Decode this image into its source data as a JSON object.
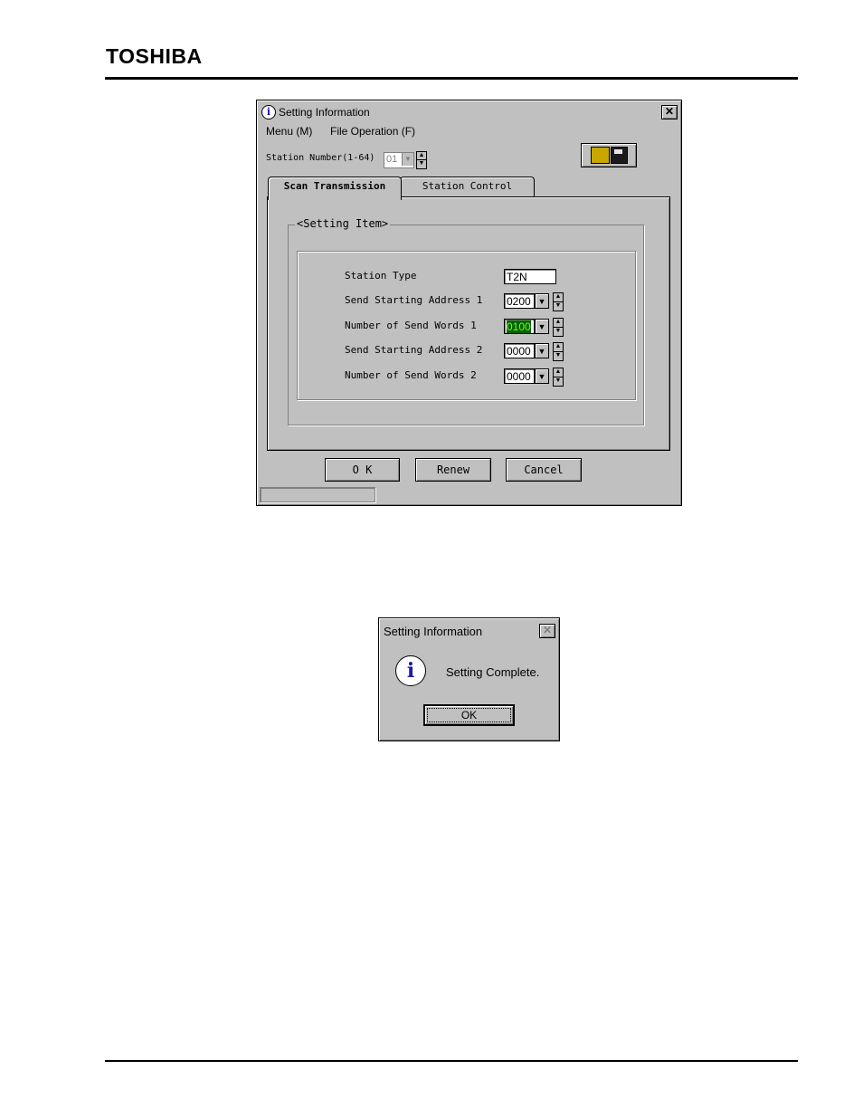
{
  "header": {
    "brand": "TOSHIBA"
  },
  "main_window": {
    "title": "Setting Information",
    "menu": [
      {
        "label": "Menu (M)"
      },
      {
        "label": "File Operation (F)"
      }
    ],
    "station_number": {
      "label": "Station Number(1-64)",
      "value": "01"
    },
    "tabs": [
      {
        "label": "Scan Transmission",
        "active": true
      },
      {
        "label": "Station Control",
        "active": false
      }
    ],
    "group_label": "<Setting Item>",
    "fields": {
      "station_type": {
        "label": "Station Type",
        "value": "T2N"
      },
      "send_start_1": {
        "label": "Send Starting Address 1",
        "value": "0200"
      },
      "send_words_1": {
        "label": "Number of Send Words 1",
        "value": "0100"
      },
      "send_start_2": {
        "label": "Send Starting Address 2",
        "value": "0000"
      },
      "send_words_2": {
        "label": "Number of Send Words 2",
        "value": "0000"
      }
    },
    "buttons": {
      "ok": "O K",
      "renew": "Renew",
      "cancel": "Cancel"
    }
  },
  "dialog": {
    "title": "Setting Information",
    "message": "Setting Complete.",
    "ok": "OK"
  },
  "icons": {
    "info": "info-icon",
    "close": "close-icon",
    "folder": "folder-open-icon",
    "floppy": "floppy-save-icon"
  },
  "colors": {
    "highlight_bg": "#006400",
    "highlight_fg": "#7cfc00",
    "window_bg": "#c0c0c0"
  }
}
